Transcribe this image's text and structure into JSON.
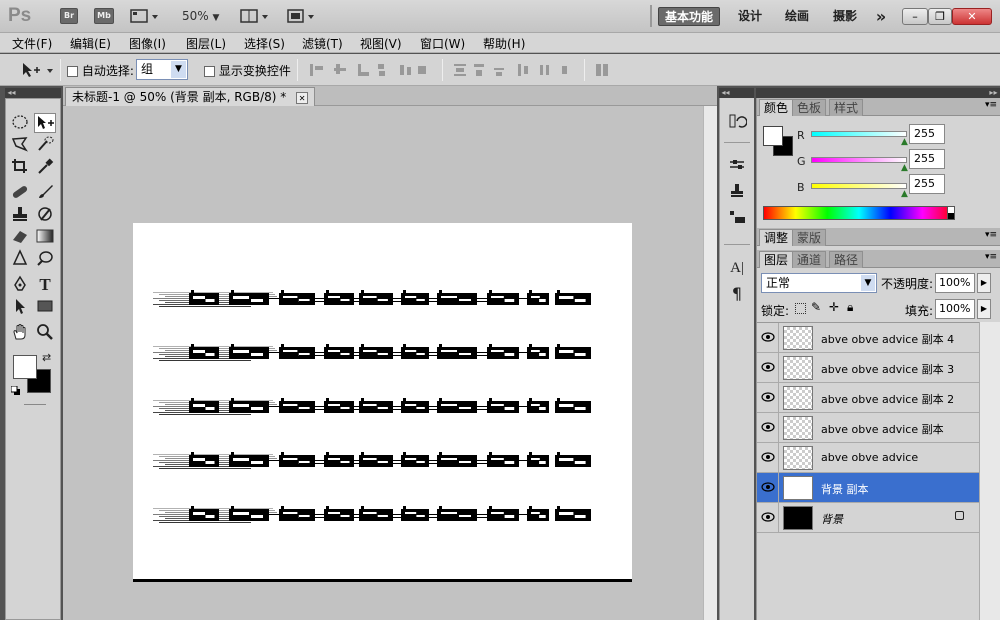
{
  "app": {
    "logo": "Ps",
    "launch_buttons": [
      "Br",
      "Mb"
    ],
    "zoom": "50%",
    "workspaces": [
      "基本功能",
      "设计",
      "绘画",
      "摄影"
    ],
    "more": "»",
    "window_controls": [
      "–",
      "❐",
      "✕"
    ]
  },
  "menu": [
    "文件(F)",
    "编辑(E)",
    "图像(I)",
    "图层(L)",
    "选择(S)",
    "滤镜(T)",
    "视图(V)",
    "窗口(W)",
    "帮助(H)"
  ],
  "options": {
    "auto_select_label": "自动选择:",
    "auto_select_value": "组",
    "show_transform_label": "显示变换控件"
  },
  "document": {
    "tab_title": "未标题-1 @ 50% (背景 副本, RGB/8) *",
    "close": "✕",
    "text_rows": 5
  },
  "color_panel": {
    "tabs": [
      "颜色",
      "色板",
      "样式"
    ],
    "channels": [
      {
        "label": "R",
        "value": "255"
      },
      {
        "label": "G",
        "value": "255"
      },
      {
        "label": "B",
        "value": "255"
      }
    ]
  },
  "adjust_panel": {
    "tabs": [
      "调整",
      "蒙版"
    ]
  },
  "layers_panel": {
    "tabs": [
      "图层",
      "通道",
      "路径"
    ],
    "blend_mode": "正常",
    "opacity_label": "不透明度:",
    "opacity_value": "100%",
    "lock_label": "锁定:",
    "fill_label": "填充:",
    "fill_value": "100%",
    "layers": [
      {
        "name": "abve obve advice 副本 4",
        "selected": false
      },
      {
        "name": "abve obve advice 副本 3",
        "selected": false
      },
      {
        "name": "abve obve advice 副本 2",
        "selected": false
      },
      {
        "name": "abve obve advice 副本",
        "selected": false
      },
      {
        "name": "abve obve advice",
        "selected": false
      },
      {
        "name": "背景 副本",
        "selected": true
      },
      {
        "name": "背景",
        "selected": false
      }
    ]
  },
  "colors": {
    "selected_layer": "#3a6fce",
    "canvas_bg": "#c2c2c2"
  }
}
